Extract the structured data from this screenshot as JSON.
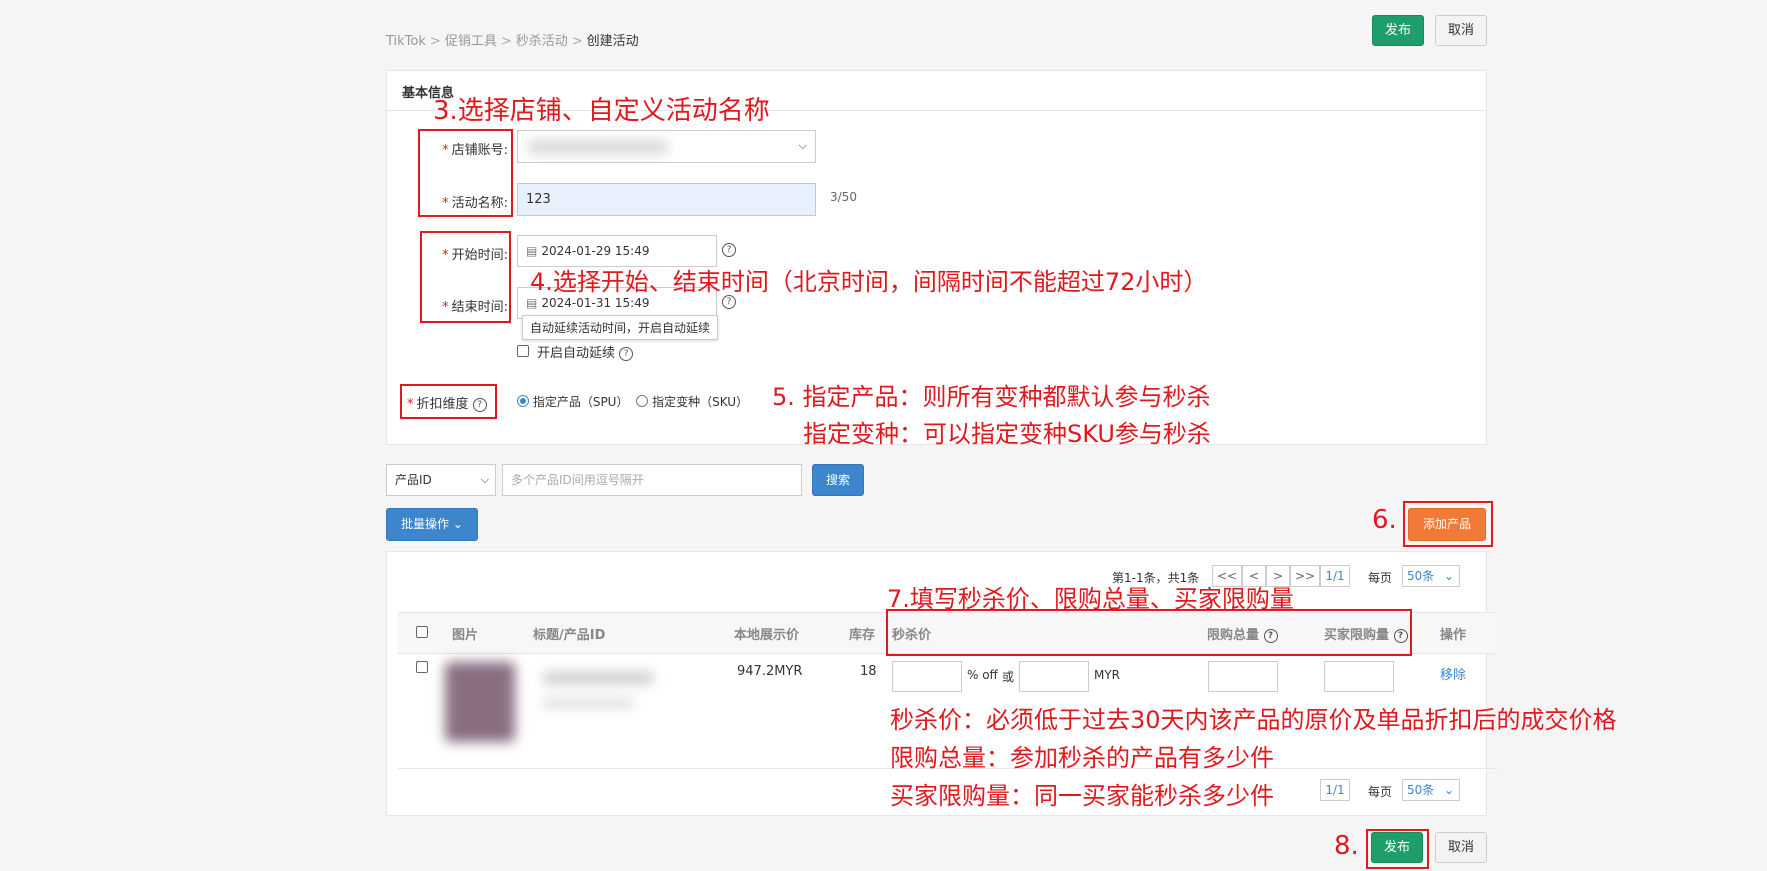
{
  "breadcrumb": [
    "TikTok",
    "促销工具",
    "秒杀活动",
    "创建活动"
  ],
  "breadcrumb_sep": ">",
  "header": {
    "publish": "发布",
    "cancel": "取消"
  },
  "basic": {
    "title": "基本信息",
    "store_label": "店铺账号:",
    "name_label": "活动名称:",
    "name_value": "123",
    "name_count": "3/50",
    "start_label": "开始时间:",
    "start_value": "2024-01-29 15:49",
    "end_label": "结束时间:",
    "end_value": "2024-01-31 15:49",
    "tooltip": "自动延续活动时间，开启自动延续",
    "auto_extend": "开启自动延续",
    "discount_label": "折扣维度",
    "opt_spu": "指定产品（SPU）",
    "opt_sku": "指定变种（SKU）"
  },
  "search": {
    "field": "产品ID",
    "placeholder": "多个产品ID间用逗号隔开",
    "button": "搜索"
  },
  "batch": "批量操作",
  "add_product": "添加产品",
  "pager": {
    "summary": "第1-1条，共1条",
    "first": "<<",
    "prev": "<",
    "next": ">",
    "last": ">>",
    "page": "1/1",
    "per_page_label": "每页",
    "per_page": "50条"
  },
  "table": {
    "headers": [
      "图片",
      "标题/产品ID",
      "本地展示价",
      "库存",
      "秒杀价",
      "限购总量",
      "买家限购量",
      "操作"
    ],
    "row": {
      "price": "947.2MYR",
      "stock": "18",
      "pct": "% off",
      "or": "或",
      "currency": "MYR",
      "remove": "移除"
    }
  },
  "footer": {
    "publish": "发布",
    "cancel": "取消"
  },
  "annotations": {
    "a3": "3.选择店铺、自定义活动名称",
    "a4": "4.选择开始、结束时间（北京时间，间隔时间不能超过72小时）",
    "a5_1": "5. 指定产品：则所有变种都默认参与秒杀",
    "a5_2": "指定变种：可以指定变种SKU参与秒杀",
    "a6": "6.",
    "a7": "7.填写秒杀价、限购总量、买家限购量",
    "a7_1": "秒杀价：必须低于过去30天内该产品的原价及单品折扣后的成交价格",
    "a7_2": "限购总量：参加秒杀的产品有多少件",
    "a7_3": "买家限购量：同一买家能秒杀多少件",
    "a8": "8."
  },
  "colors": {
    "annotation": "#e0191f",
    "publish": "#1e9e69",
    "primary": "#3d86cc",
    "add": "#f07a36"
  }
}
